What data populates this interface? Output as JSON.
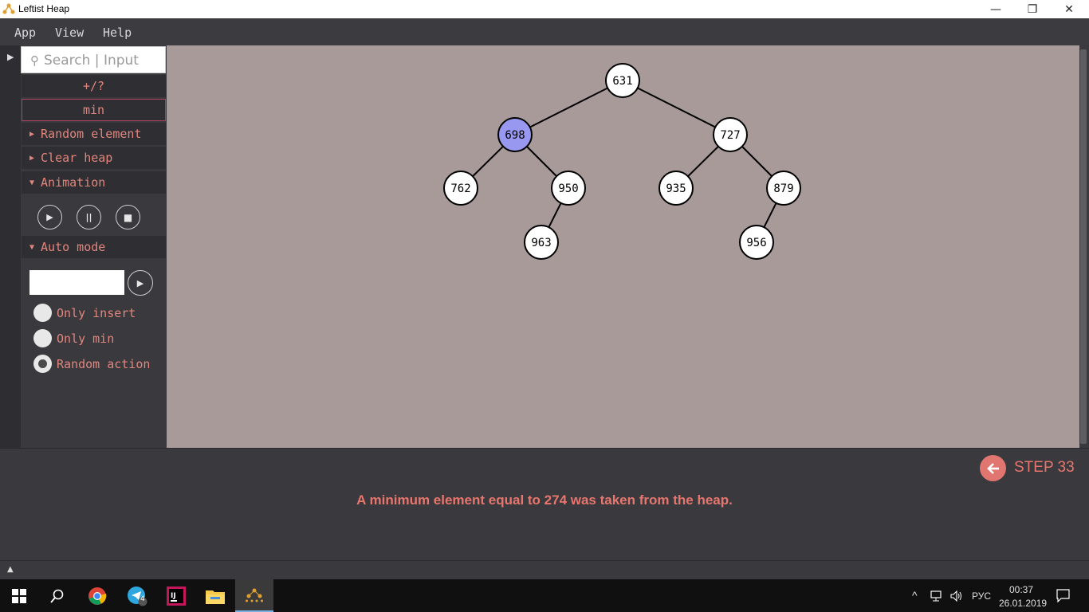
{
  "window": {
    "title": "Leftist Heap"
  },
  "menu": [
    "App",
    "View",
    "Help"
  ],
  "sidebar": {
    "search_placeholder": "Search | Input",
    "insert_button": "+/?",
    "min_button": "min",
    "random_element": "Random element",
    "clear_heap": "Clear heap",
    "animation": "Animation",
    "auto_mode": "Auto mode",
    "auto_input_value": "",
    "radios": [
      {
        "label": "Only insert",
        "checked": false
      },
      {
        "label": "Only min",
        "checked": false
      },
      {
        "label": "Random action",
        "checked": true
      }
    ]
  },
  "tree": {
    "nodes": [
      {
        "id": "631",
        "label": "631",
        "highlight": false
      },
      {
        "id": "698",
        "label": "698",
        "highlight": true
      },
      {
        "id": "727",
        "label": "727",
        "highlight": false
      },
      {
        "id": "762",
        "label": "762",
        "highlight": false
      },
      {
        "id": "950",
        "label": "950",
        "highlight": false
      },
      {
        "id": "935",
        "label": "935",
        "highlight": false
      },
      {
        "id": "879",
        "label": "879",
        "highlight": false
      },
      {
        "id": "963",
        "label": "963",
        "highlight": false
      },
      {
        "id": "956",
        "label": "956",
        "highlight": false
      }
    ],
    "edges": [
      [
        "631",
        "698"
      ],
      [
        "631",
        "727"
      ],
      [
        "698",
        "762"
      ],
      [
        "698",
        "950"
      ],
      [
        "727",
        "935"
      ],
      [
        "727",
        "879"
      ],
      [
        "950",
        "963"
      ],
      [
        "879",
        "956"
      ]
    ],
    "highlight_color": "#9898f0"
  },
  "status": {
    "step_label": "STEP 33",
    "message": "A minimum element equal to 274 was taken from the heap.",
    "accent": "#e8766e"
  },
  "taskbar": {
    "language": "РУС",
    "time": "00:37",
    "date": "26.01.2019",
    "telegram_badge": "4"
  }
}
